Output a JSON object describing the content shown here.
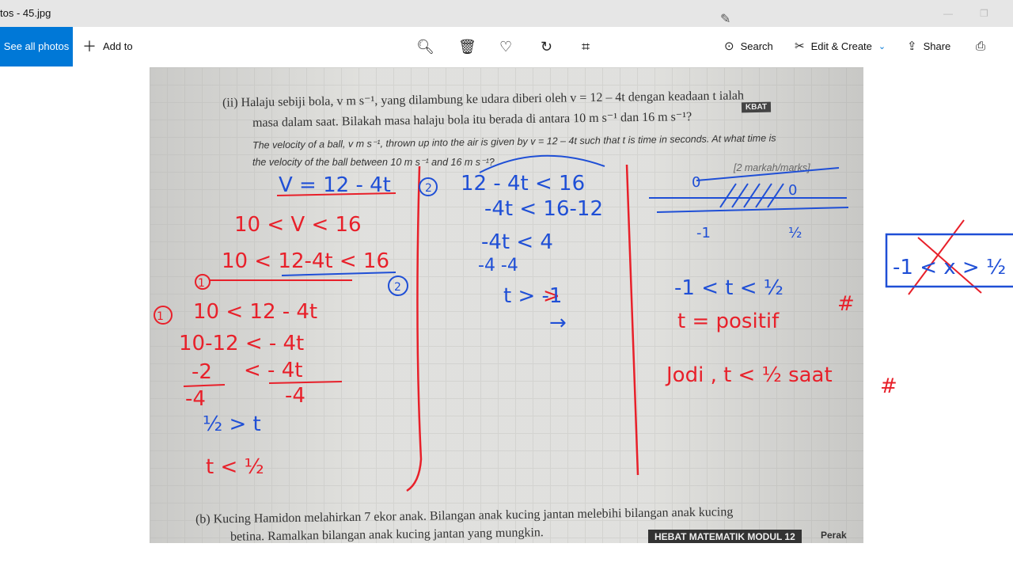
{
  "window": {
    "title": "tos - 45.jpg"
  },
  "toolbar": {
    "see_all": "See all photos",
    "add_to": "Add to",
    "search": "Search",
    "edit_create": "Edit & Create",
    "share": "Share"
  },
  "icons": [
    "plus-icon",
    "zoom-in-icon",
    "delete-icon",
    "heart-icon",
    "rotate-icon",
    "crop-icon",
    "search-lens-icon",
    "edit-icon",
    "chevron-down-icon",
    "share-icon",
    "print-icon",
    "pen-icon"
  ],
  "colors": {
    "accent": "#0078d7",
    "ink_red": "#e8202a",
    "ink_blue": "#1f4fd6"
  },
  "photo": {
    "line1": "(ii)  Halaju sebiji bola, v m s⁻¹, yang dilambung ke udara diberi oleh v = 12 – 4t dengan keadaan t ialah",
    "line2": "masa dalam saat. Bilakah masa halaju bola itu berada di antara 10 m s⁻¹ dan 16 m s⁻¹?",
    "kbat": "KBAT",
    "line3": "The velocity of a ball, v m s⁻¹, thrown up into the air is given by v = 12 – 4t such that t is time in seconds. At what time is",
    "line4": "the velocity of the ball between 10 m s⁻¹ and 16 m s⁻¹?",
    "marks": "[2 markah/marks]",
    "b1": "(b)   Kucing Hamidon melahirkan 7 ekor anak. Bilangan anak kucing jantan melebihi bilangan anak kucing",
    "b2": "betina. Ramalkan bilangan anak kucing jantan yang mungkin.",
    "footer": "HEBAT MATEMATIK MODUL 12",
    "perak": "Perak",
    "hand": {
      "l1": "V = 12 - 4t",
      "l2": "10 < V < 16",
      "l3": "10 < 12-4t < 16",
      "c1": "1",
      "c2": "2",
      "l4": "10 < 12 - 4t",
      "l5": "10-12 < - 4t",
      "l6a": "-2",
      "l6b": "< - 4t",
      "l6c": "-4",
      "l6d": "-4",
      "l7": "½  > t",
      "l8": "t < ½",
      "m0": "2",
      "m1": "12 - 4t < 16",
      "m2": "-4t < 16-12",
      "m3": "-4t  <  4",
      "m3b": "-4      -4",
      "m4": "t  >  -1",
      "m5": "→",
      "n0": "0",
      "n00": "0",
      "nm1": "-1",
      "nh": "½",
      "r1": "-1 < t < ½",
      "r2": "t = positif",
      "r3": "Jodi , t < ½  saat",
      "hash": "#",
      "side": "-1 < x > ½"
    }
  }
}
